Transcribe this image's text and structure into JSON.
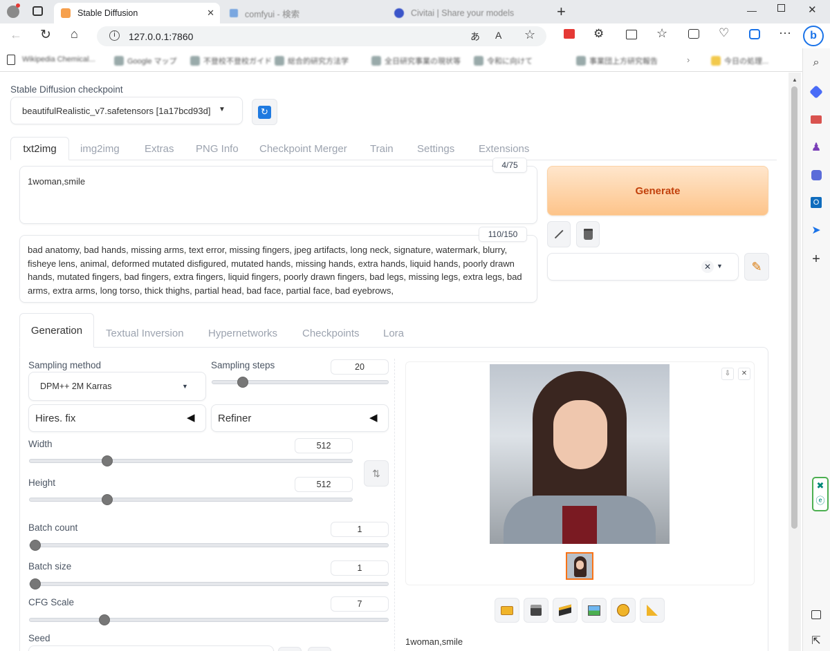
{
  "browser": {
    "tabs": [
      {
        "title": "Stable Diffusion",
        "active": true
      },
      {
        "title": "comfyui - 検索",
        "active": false
      },
      {
        "title": "Civitai | Share your models",
        "active": false
      }
    ],
    "url": "127.0.0.1:7860",
    "bookmarks": [
      "Wikipedia Chemical...",
      "Google マップ",
      "不登校不登校ガイド",
      "総合的研究方法学",
      "全日研究事業の現状等",
      "令和に向けて",
      "事業団上方研究報告",
      "今日の処理..."
    ]
  },
  "checkpoint": {
    "label": "Stable Diffusion checkpoint",
    "value": "beautifulRealistic_v7.safetensors [1a17bcd93d]"
  },
  "main_tabs": [
    "txt2img",
    "img2img",
    "Extras",
    "PNG Info",
    "Checkpoint Merger",
    "Train",
    "Settings",
    "Extensions"
  ],
  "prompt": {
    "text": "1woman,smile",
    "counter": "4/75"
  },
  "negative_prompt": {
    "text": "bad anatomy, bad hands, missing arms, text error, missing fingers, jpeg artifacts, long neck, signature, watermark, blurry, fisheye lens, animal, deformed mutated disfigured, mutated hands, missing hands, extra hands, liquid hands, poorly drawn hands, mutated fingers, bad fingers, extra fingers, liquid fingers, poorly drawn fingers, bad legs, missing legs, extra legs, bad arms, extra arms, long torso, thick thighs, partial head, bad face, partial face, bad eyebrows,",
    "counter": "110/150"
  },
  "generate_label": "Generate",
  "sub_tabs": [
    "Generation",
    "Textual Inversion",
    "Hypernetworks",
    "Checkpoints",
    "Lora"
  ],
  "params": {
    "sampling_method": {
      "label": "Sampling method",
      "value": "DPM++ 2M Karras"
    },
    "sampling_steps": {
      "label": "Sampling steps",
      "value": "20",
      "fraction": 0.15
    },
    "hires_fix": "Hires. fix",
    "refiner": "Refiner",
    "width": {
      "label": "Width",
      "value": "512",
      "fraction": 0.23
    },
    "height": {
      "label": "Height",
      "value": "512",
      "fraction": 0.23
    },
    "batch_count": {
      "label": "Batch count",
      "value": "1",
      "fraction": 0
    },
    "batch_size": {
      "label": "Batch size",
      "value": "1",
      "fraction": 0
    },
    "cfg_scale": {
      "label": "CFG Scale",
      "value": "7",
      "fraction": 0.2
    },
    "seed": {
      "label": "Seed"
    }
  },
  "output": {
    "caption": "1woman,smile"
  },
  "icons": {
    "refresh": "refresh-icon",
    "trash": "trash-icon",
    "pencil": "pencil-icon",
    "swap": "swap-icon",
    "folder": "folder-icon",
    "save": "save-icon",
    "zip": "zip-icon",
    "image": "image-icon",
    "palette": "palette-icon",
    "ruler": "ruler-icon"
  },
  "colors": {
    "accent": "#f97316",
    "generate_bg": "#fdd4a7",
    "generate_text": "#c2410c",
    "selected_thumb": "#f97316"
  }
}
